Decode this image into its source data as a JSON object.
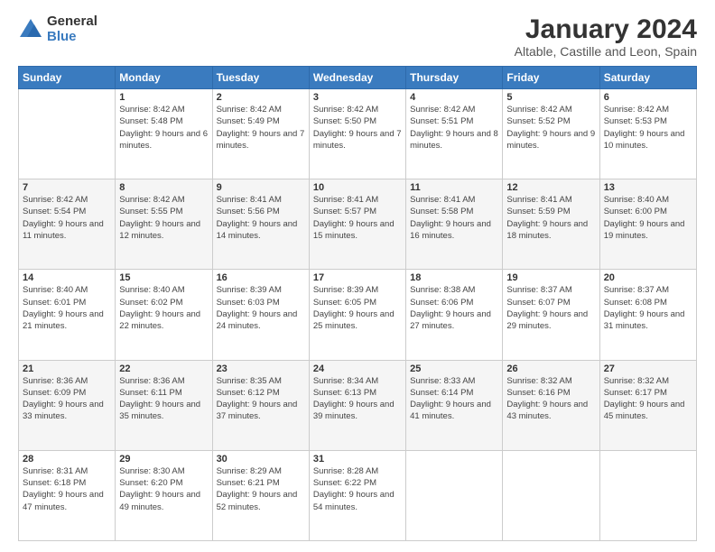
{
  "logo": {
    "general": "General",
    "blue": "Blue"
  },
  "title": "January 2024",
  "subtitle": "Altable, Castille and Leon, Spain",
  "weekdays": [
    "Sunday",
    "Monday",
    "Tuesday",
    "Wednesday",
    "Thursday",
    "Friday",
    "Saturday"
  ],
  "weeks": [
    [
      {
        "day": "",
        "sunrise": "",
        "sunset": "",
        "daylight": ""
      },
      {
        "day": "1",
        "sunrise": "Sunrise: 8:42 AM",
        "sunset": "Sunset: 5:48 PM",
        "daylight": "Daylight: 9 hours and 6 minutes."
      },
      {
        "day": "2",
        "sunrise": "Sunrise: 8:42 AM",
        "sunset": "Sunset: 5:49 PM",
        "daylight": "Daylight: 9 hours and 7 minutes."
      },
      {
        "day": "3",
        "sunrise": "Sunrise: 8:42 AM",
        "sunset": "Sunset: 5:50 PM",
        "daylight": "Daylight: 9 hours and 7 minutes."
      },
      {
        "day": "4",
        "sunrise": "Sunrise: 8:42 AM",
        "sunset": "Sunset: 5:51 PM",
        "daylight": "Daylight: 9 hours and 8 minutes."
      },
      {
        "day": "5",
        "sunrise": "Sunrise: 8:42 AM",
        "sunset": "Sunset: 5:52 PM",
        "daylight": "Daylight: 9 hours and 9 minutes."
      },
      {
        "day": "6",
        "sunrise": "Sunrise: 8:42 AM",
        "sunset": "Sunset: 5:53 PM",
        "daylight": "Daylight: 9 hours and 10 minutes."
      }
    ],
    [
      {
        "day": "7",
        "sunrise": "Sunrise: 8:42 AM",
        "sunset": "Sunset: 5:54 PM",
        "daylight": "Daylight: 9 hours and 11 minutes."
      },
      {
        "day": "8",
        "sunrise": "Sunrise: 8:42 AM",
        "sunset": "Sunset: 5:55 PM",
        "daylight": "Daylight: 9 hours and 12 minutes."
      },
      {
        "day": "9",
        "sunrise": "Sunrise: 8:41 AM",
        "sunset": "Sunset: 5:56 PM",
        "daylight": "Daylight: 9 hours and 14 minutes."
      },
      {
        "day": "10",
        "sunrise": "Sunrise: 8:41 AM",
        "sunset": "Sunset: 5:57 PM",
        "daylight": "Daylight: 9 hours and 15 minutes."
      },
      {
        "day": "11",
        "sunrise": "Sunrise: 8:41 AM",
        "sunset": "Sunset: 5:58 PM",
        "daylight": "Daylight: 9 hours and 16 minutes."
      },
      {
        "day": "12",
        "sunrise": "Sunrise: 8:41 AM",
        "sunset": "Sunset: 5:59 PM",
        "daylight": "Daylight: 9 hours and 18 minutes."
      },
      {
        "day": "13",
        "sunrise": "Sunrise: 8:40 AM",
        "sunset": "Sunset: 6:00 PM",
        "daylight": "Daylight: 9 hours and 19 minutes."
      }
    ],
    [
      {
        "day": "14",
        "sunrise": "Sunrise: 8:40 AM",
        "sunset": "Sunset: 6:01 PM",
        "daylight": "Daylight: 9 hours and 21 minutes."
      },
      {
        "day": "15",
        "sunrise": "Sunrise: 8:40 AM",
        "sunset": "Sunset: 6:02 PM",
        "daylight": "Daylight: 9 hours and 22 minutes."
      },
      {
        "day": "16",
        "sunrise": "Sunrise: 8:39 AM",
        "sunset": "Sunset: 6:03 PM",
        "daylight": "Daylight: 9 hours and 24 minutes."
      },
      {
        "day": "17",
        "sunrise": "Sunrise: 8:39 AM",
        "sunset": "Sunset: 6:05 PM",
        "daylight": "Daylight: 9 hours and 25 minutes."
      },
      {
        "day": "18",
        "sunrise": "Sunrise: 8:38 AM",
        "sunset": "Sunset: 6:06 PM",
        "daylight": "Daylight: 9 hours and 27 minutes."
      },
      {
        "day": "19",
        "sunrise": "Sunrise: 8:37 AM",
        "sunset": "Sunset: 6:07 PM",
        "daylight": "Daylight: 9 hours and 29 minutes."
      },
      {
        "day": "20",
        "sunrise": "Sunrise: 8:37 AM",
        "sunset": "Sunset: 6:08 PM",
        "daylight": "Daylight: 9 hours and 31 minutes."
      }
    ],
    [
      {
        "day": "21",
        "sunrise": "Sunrise: 8:36 AM",
        "sunset": "Sunset: 6:09 PM",
        "daylight": "Daylight: 9 hours and 33 minutes."
      },
      {
        "day": "22",
        "sunrise": "Sunrise: 8:36 AM",
        "sunset": "Sunset: 6:11 PM",
        "daylight": "Daylight: 9 hours and 35 minutes."
      },
      {
        "day": "23",
        "sunrise": "Sunrise: 8:35 AM",
        "sunset": "Sunset: 6:12 PM",
        "daylight": "Daylight: 9 hours and 37 minutes."
      },
      {
        "day": "24",
        "sunrise": "Sunrise: 8:34 AM",
        "sunset": "Sunset: 6:13 PM",
        "daylight": "Daylight: 9 hours and 39 minutes."
      },
      {
        "day": "25",
        "sunrise": "Sunrise: 8:33 AM",
        "sunset": "Sunset: 6:14 PM",
        "daylight": "Daylight: 9 hours and 41 minutes."
      },
      {
        "day": "26",
        "sunrise": "Sunrise: 8:32 AM",
        "sunset": "Sunset: 6:16 PM",
        "daylight": "Daylight: 9 hours and 43 minutes."
      },
      {
        "day": "27",
        "sunrise": "Sunrise: 8:32 AM",
        "sunset": "Sunset: 6:17 PM",
        "daylight": "Daylight: 9 hours and 45 minutes."
      }
    ],
    [
      {
        "day": "28",
        "sunrise": "Sunrise: 8:31 AM",
        "sunset": "Sunset: 6:18 PM",
        "daylight": "Daylight: 9 hours and 47 minutes."
      },
      {
        "day": "29",
        "sunrise": "Sunrise: 8:30 AM",
        "sunset": "Sunset: 6:20 PM",
        "daylight": "Daylight: 9 hours and 49 minutes."
      },
      {
        "day": "30",
        "sunrise": "Sunrise: 8:29 AM",
        "sunset": "Sunset: 6:21 PM",
        "daylight": "Daylight: 9 hours and 52 minutes."
      },
      {
        "day": "31",
        "sunrise": "Sunrise: 8:28 AM",
        "sunset": "Sunset: 6:22 PM",
        "daylight": "Daylight: 9 hours and 54 minutes."
      },
      {
        "day": "",
        "sunrise": "",
        "sunset": "",
        "daylight": ""
      },
      {
        "day": "",
        "sunrise": "",
        "sunset": "",
        "daylight": ""
      },
      {
        "day": "",
        "sunrise": "",
        "sunset": "",
        "daylight": ""
      }
    ]
  ]
}
